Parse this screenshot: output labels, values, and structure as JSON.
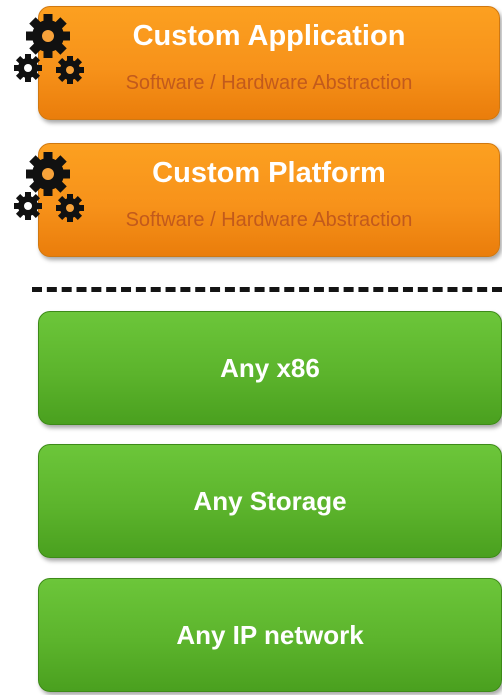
{
  "layers": {
    "custom": [
      {
        "title": "Custom Application",
        "subtitle": "Software / Hardware Abstraction",
        "icon": "gears-icon"
      },
      {
        "title": "Custom Platform",
        "subtitle": "Software / Hardware Abstraction",
        "icon": "gears-icon"
      }
    ],
    "infrastructure": [
      {
        "label": "Any x86"
      },
      {
        "label": "Any Storage"
      },
      {
        "label": "Any IP network"
      }
    ]
  },
  "colors": {
    "custom_fill": "#f7921a",
    "custom_subtitle": "#c25a1c",
    "infra_fill": "#5cb42c",
    "divider": "#141414",
    "gear": "#111111",
    "label": "#ffffff"
  }
}
